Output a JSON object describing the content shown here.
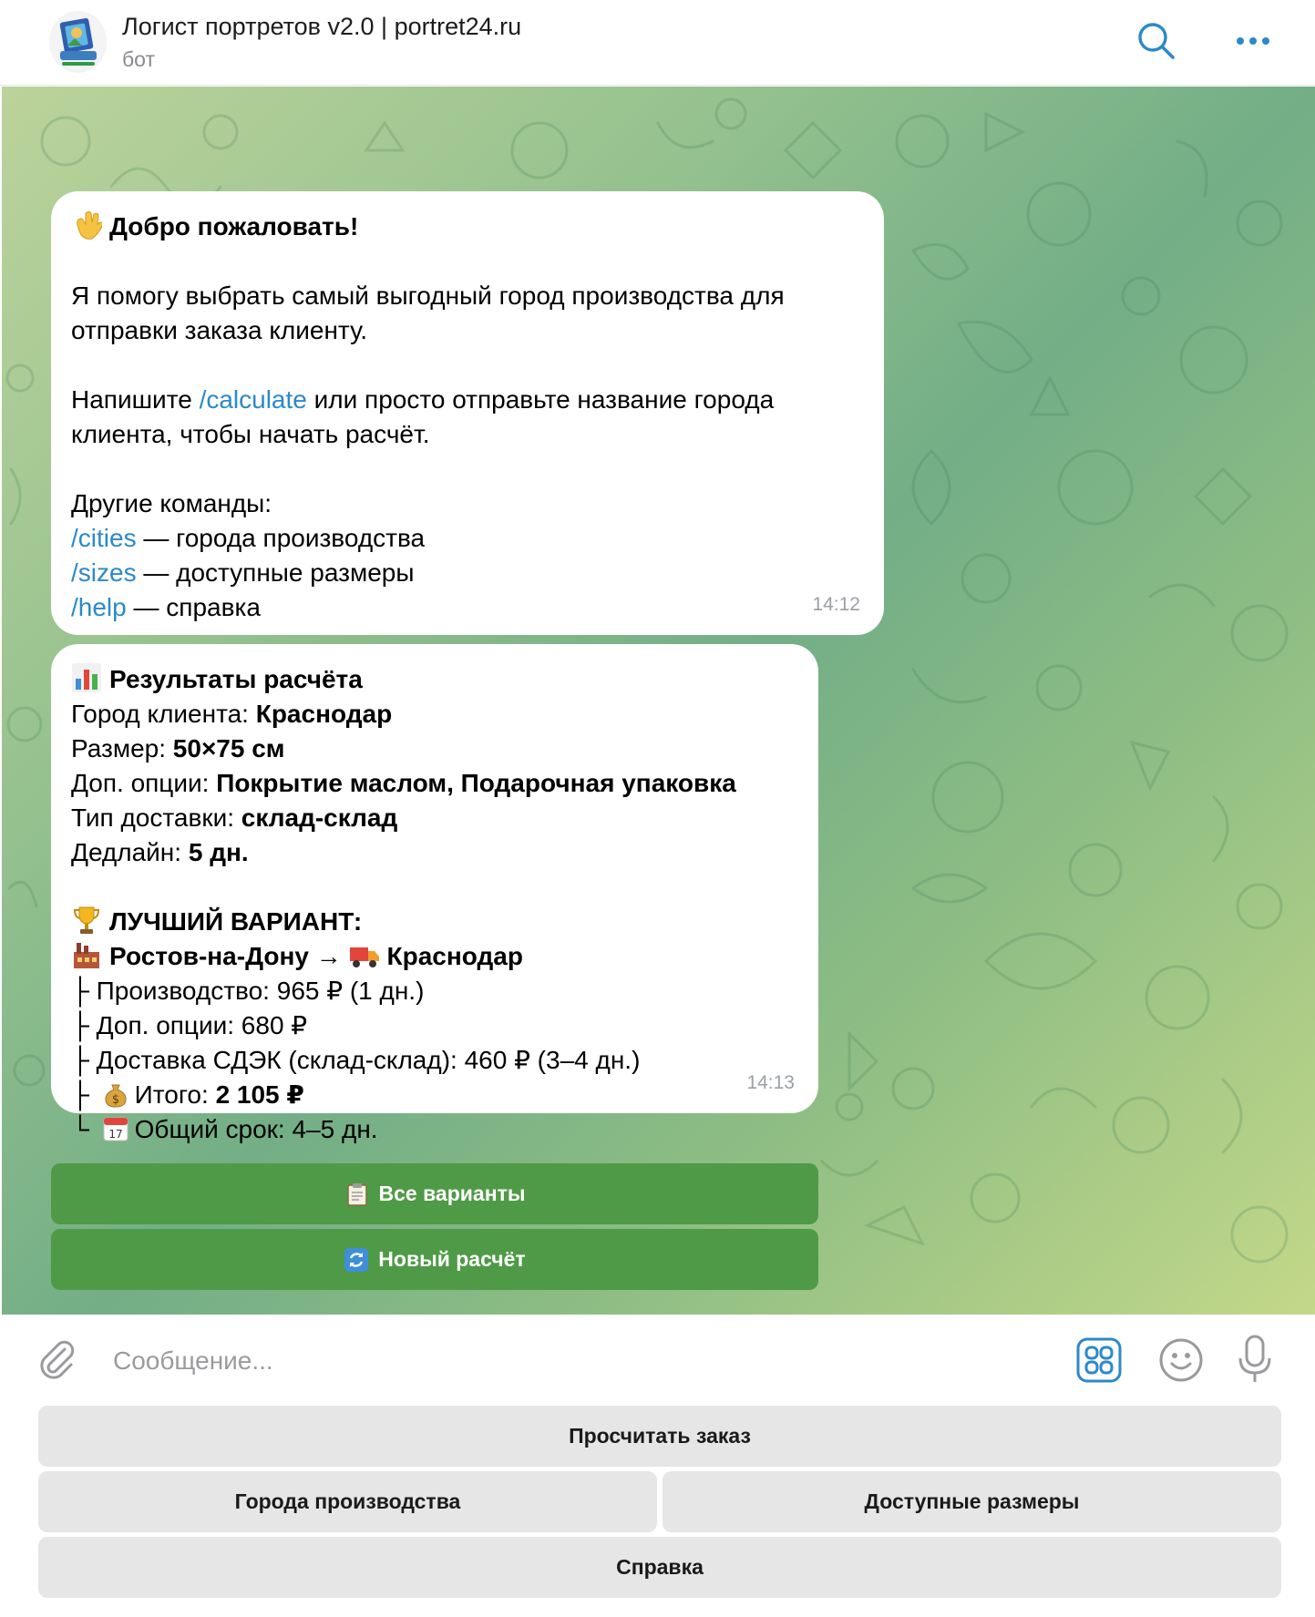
{
  "header": {
    "title": "Логист портретов v2.0 | portret24.ru",
    "subtitle": "бот",
    "avatar_icon": "bot-avatar-logo",
    "search_icon": "search-icon",
    "more_icon": "more-icon"
  },
  "messages": [
    {
      "time": "14:12",
      "greeting": "Добро пожаловать!",
      "greeting_emoji": "waving-hand",
      "intro": [
        "Я помогу выбрать самый выгодный город производства для",
        "отправки заказа клиенту."
      ],
      "calc_line": {
        "before": "Напишите ",
        "cmd": "/calculate",
        "after": " или просто отправьте название города"
      },
      "calc_line2": "клиента, чтобы начать расчёт.",
      "other_title": "Другие команды:",
      "commands": [
        {
          "cmd": "/cities",
          "desc": " — города производства"
        },
        {
          "cmd": "/sizes",
          "desc": " — доступные размеры"
        },
        {
          "cmd": "/help",
          "desc": " — справка"
        }
      ]
    },
    {
      "time": "14:13",
      "title": "Результаты расчёта",
      "title_emoji": "bar-chart",
      "fields": [
        {
          "label": "Город клиента: ",
          "value": "Краснодар"
        },
        {
          "label": "Размер: ",
          "value": "50×75 см"
        },
        {
          "label": "Доп. опции: ",
          "value": "Покрытие маслом, Подарочная упаковка"
        },
        {
          "label": "Тип доставки: ",
          "value": "склад-склад"
        },
        {
          "label": "Дедлайн: ",
          "value": "5 дн."
        }
      ],
      "best_title": "ЛУЧШИЙ ВАРИАНТ:",
      "best_emoji": "trophy",
      "route_from": "Ростов-на-Дону",
      "route_arrow": "→",
      "route_to": "Краснодар",
      "route_from_emoji": "factory",
      "route_to_emoji": "delivery-truck",
      "details": [
        {
          "prefix": "├ ",
          "text": "Производство: 965 ₽ (1 дн.)"
        },
        {
          "prefix": "├ ",
          "text": "Доп. опции: 680 ₽"
        },
        {
          "prefix": "├ ",
          "text": "Доставка СДЭК (склад-склад): 460 ₽ (3–4 дн.)"
        }
      ],
      "total": {
        "prefix": "├ ",
        "emoji": "money-bag",
        "label": "Итого: ",
        "value": "2 105 ₽"
      },
      "term": {
        "prefix": "└ ",
        "emoji": "calendar",
        "text": "Общий срок: 4–5 дн."
      },
      "calendar_day": "17"
    }
  ],
  "inline_buttons": [
    {
      "label": "Все варианты",
      "icon": "clipboard-icon"
    },
    {
      "label": "Новый расчёт",
      "icon": "refresh-icon"
    }
  ],
  "input": {
    "placeholder": "Сообщение...",
    "value": "",
    "attach_icon": "paperclip-icon",
    "keyboard_icon": "bot-keyboard-icon",
    "emoji_icon": "smile-icon",
    "mic_icon": "microphone-icon"
  },
  "reply_keyboard": {
    "row1": [
      "Просчитать заказ"
    ],
    "row2": [
      "Города производства",
      "Доступные размеры"
    ],
    "row3": [
      "Справка"
    ]
  },
  "colors": {
    "accent": "#2b89c9",
    "inline_button": "#4f9a46",
    "reply_button": "#e6e6e6",
    "bubble": "#ffffff"
  }
}
